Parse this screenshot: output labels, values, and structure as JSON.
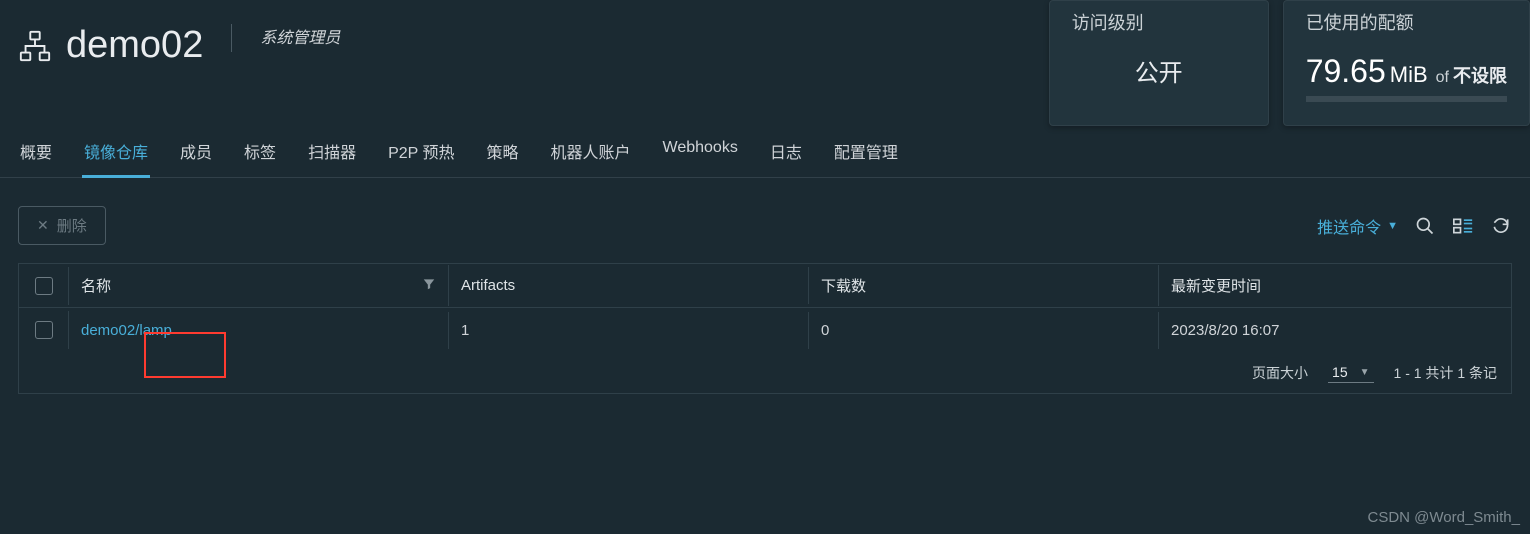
{
  "header": {
    "title": "demo02",
    "role": "系统管理员"
  },
  "cards": {
    "access": {
      "title": "访问级别",
      "value": "公开"
    },
    "quota": {
      "title": "已使用的配额",
      "value": "79.65",
      "unit": "MiB",
      "of": "of",
      "limit": "不设限"
    }
  },
  "tabs": [
    {
      "label": "概要",
      "active": false
    },
    {
      "label": "镜像仓库",
      "active": true
    },
    {
      "label": "成员",
      "active": false
    },
    {
      "label": "标签",
      "active": false
    },
    {
      "label": "扫描器",
      "active": false
    },
    {
      "label": "P2P 预热",
      "active": false
    },
    {
      "label": "策略",
      "active": false
    },
    {
      "label": "机器人账户",
      "active": false
    },
    {
      "label": "Webhooks",
      "active": false
    },
    {
      "label": "日志",
      "active": false
    },
    {
      "label": "配置管理",
      "active": false
    }
  ],
  "toolbar": {
    "delete_label": "删除",
    "push_cmd_label": "推送命令"
  },
  "table": {
    "headers": {
      "name": "名称",
      "artifacts": "Artifacts",
      "downloads": "下载数",
      "updated": "最新变更时间"
    },
    "rows": [
      {
        "name": "demo02/lamp",
        "artifacts": "1",
        "downloads": "0",
        "updated": "2023/8/20 16:07"
      }
    ],
    "footer": {
      "pagesize_label": "页面大小",
      "pagesize_value": "15",
      "range": "1 - 1 共计 1 条记"
    }
  },
  "watermark": "CSDN @Word_Smith_"
}
